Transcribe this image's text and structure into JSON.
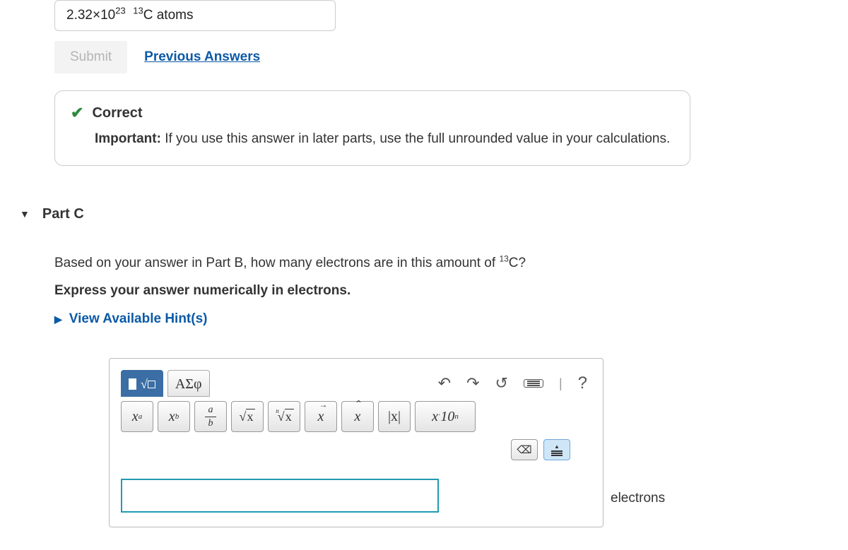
{
  "answer_display": {
    "coeff": "2.32×10",
    "exp": "23",
    "isotope_mass": "13",
    "isotope_sym": "C",
    "unit_word": " atoms"
  },
  "buttons": {
    "submit": "Submit",
    "previous": "Previous Answers"
  },
  "feedback": {
    "status": "Correct",
    "important_label": "Important:",
    "important_text": " If you use this answer in later parts, use the full unrounded value in your calculations."
  },
  "partC": {
    "label": "Part C",
    "question_pre": "Based on your answer in Part B, how many electrons are in this amount of ",
    "isotope_mass": "13",
    "isotope_sym": "C",
    "question_post": "?",
    "instruction": "Express your answer numerically in electrons.",
    "hints": "View Available Hint(s)"
  },
  "editor": {
    "tab_greek": "ΑΣφ",
    "help": "?",
    "btn_xa": "x",
    "btn_xa_sup": "a",
    "btn_xb": "x",
    "btn_xb_sub": "b",
    "frac_top": "a",
    "frac_bot": "b",
    "sqrt_x": "x",
    "nroot_n": "n",
    "nroot_x": "x",
    "vec_x": "x",
    "hat_x": "x",
    "abs_x": "|x|",
    "sci": "x",
    "sci_dot": "·",
    "sci_ten": "10",
    "sci_n": "n",
    "backspace": "⌫",
    "units": "electrons"
  }
}
